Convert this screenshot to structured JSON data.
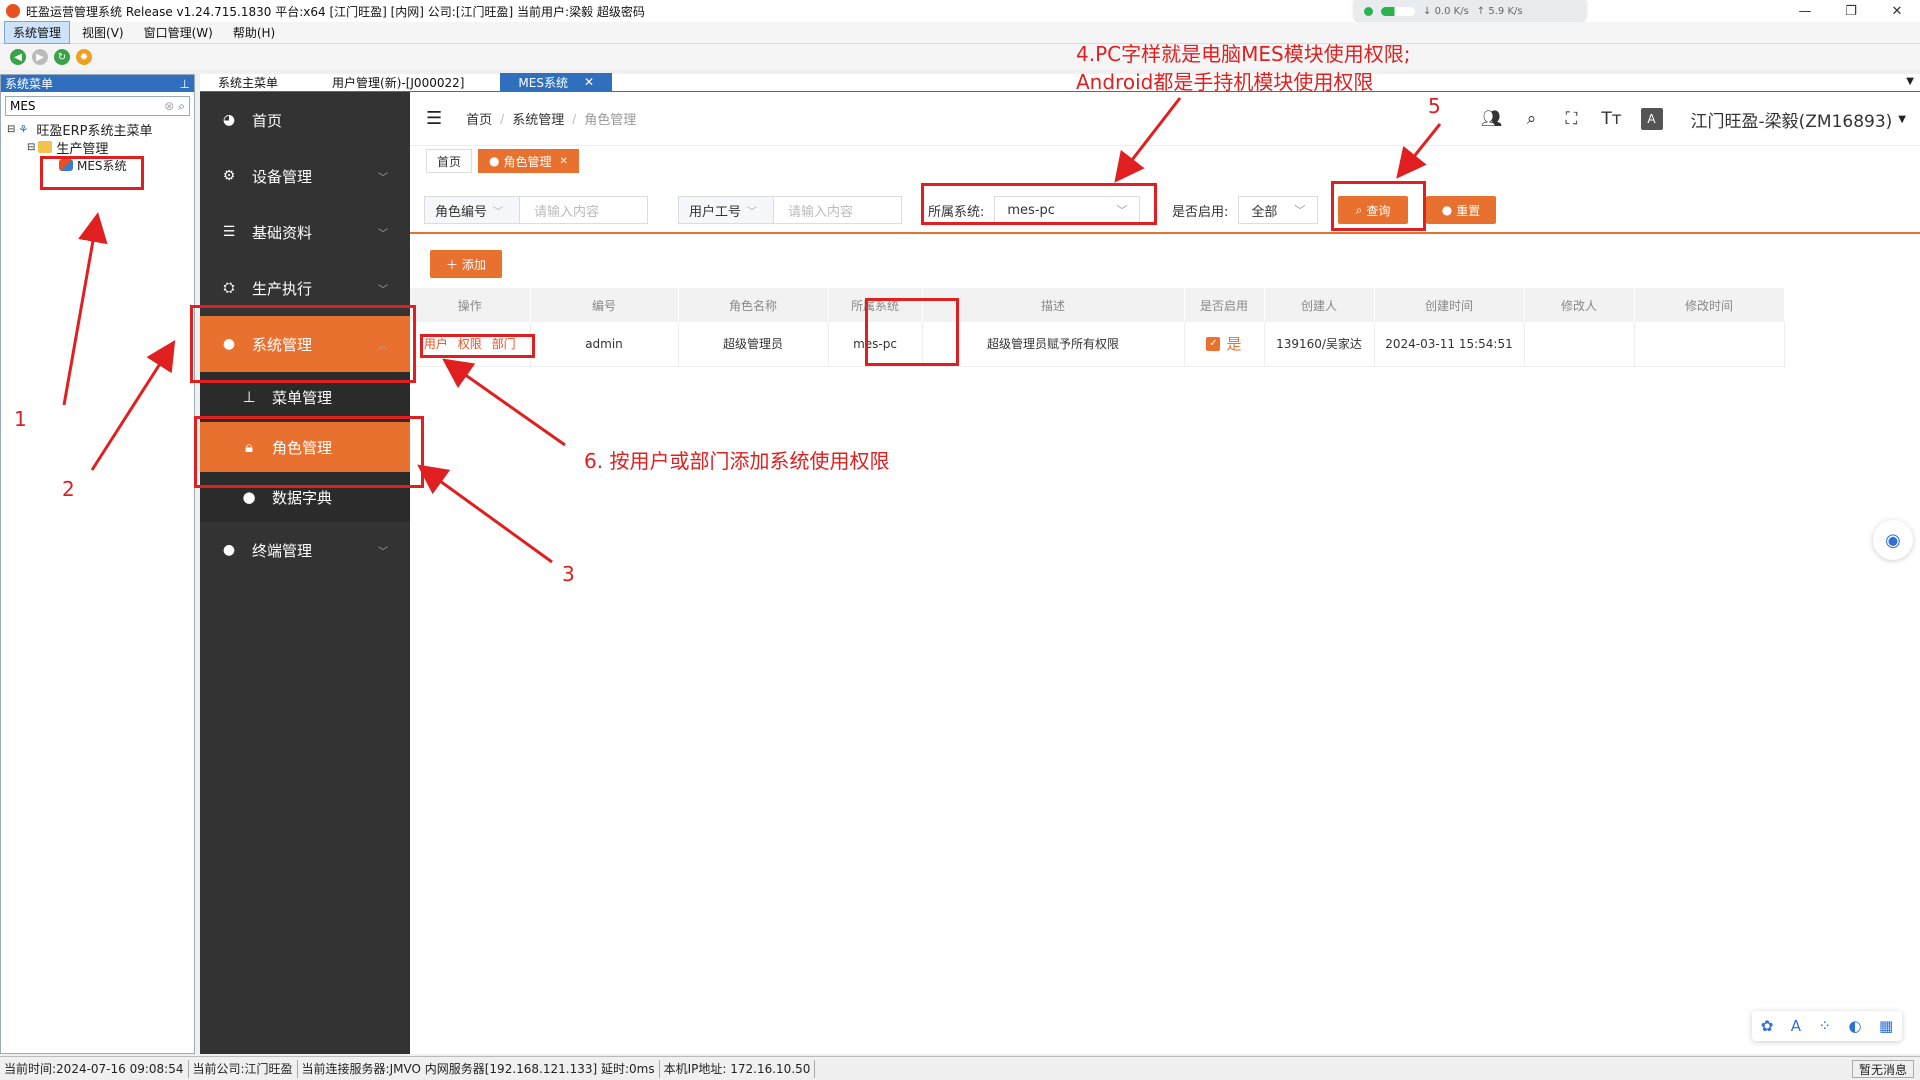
{
  "window": {
    "title": "旺盈运营管理系统 Release v1.24.715.1830 平台:x64 [江门旺盈] [内网] 公司:[江门旺盈] 当前用户:梁毅 超级密码",
    "netmon": {
      "down": "0.0",
      "up": "5.9",
      "unit": "K/s"
    }
  },
  "menubar": [
    "系统管理",
    "视图(V)",
    "窗口管理(W)",
    "帮助(H)"
  ],
  "left_panel": {
    "title": "系统菜单",
    "search_value": "MES",
    "tree": [
      {
        "label": "旺盈ERP系统主菜单",
        "level": 0
      },
      {
        "label": "生产管理",
        "level": 1
      },
      {
        "label": "MES系统",
        "level": 2
      }
    ]
  },
  "doc_tabs": [
    "系统主菜单",
    "用户管理(新)-[J000022]",
    "MES系统"
  ],
  "sidebar": {
    "items": [
      {
        "label": "首页",
        "icon": "dashboard-icon",
        "chev": false
      },
      {
        "label": "设备管理",
        "icon": "gears-icon",
        "chev": true
      },
      {
        "label": "基础资料",
        "icon": "list-icon",
        "chev": true
      },
      {
        "label": "生产执行",
        "icon": "factory-icon",
        "chev": true
      },
      {
        "label": "系统管理",
        "icon": "user-icon",
        "chev": true,
        "active": true
      }
    ],
    "sub_items": [
      {
        "label": "菜单管理",
        "icon": "sitemap-icon"
      },
      {
        "label": "角色管理",
        "icon": "lock-icon",
        "active": true
      },
      {
        "label": "数据字典",
        "icon": "user-icon"
      }
    ],
    "last_item": {
      "label": "终端管理",
      "icon": "user-icon"
    }
  },
  "breadcrumb": [
    "首页",
    "系统管理",
    "角色管理"
  ],
  "user_display": "江门旺盈-梁毅(ZM16893)",
  "view_tags": {
    "home": "首页",
    "current": "角色管理"
  },
  "filters": {
    "role_code_label": "角色编号",
    "role_code_placeholder": "请输入内容",
    "user_code_label": "用户工号",
    "user_code_placeholder": "请输入内容",
    "system_label": "所属系统:",
    "system_value": "mes-pc",
    "enabled_label": "是否启用:",
    "enabled_value": "全部",
    "query_button": "查询",
    "reset_button": "重置"
  },
  "add_button": "添加",
  "table": {
    "columns": [
      "操作",
      "编号",
      "角色名称",
      "所属系统",
      "描述",
      "是否启用",
      "创建人",
      "创建时间",
      "修改人",
      "修改时间"
    ],
    "rows": [
      {
        "ops": [
          "用户",
          "权限",
          "部门"
        ],
        "code": "admin",
        "name": "超级管理员",
        "system": "mes-pc",
        "desc": "超级管理员赋予所有权限",
        "enabled": "是",
        "creator": "139160/吴家达",
        "created": "2024-03-11 15:54:51",
        "modifier": "",
        "modified": ""
      }
    ]
  },
  "annotations": {
    "n1": "1",
    "n2": "2",
    "n3": "3",
    "n4_line1": "4.PC字样就是电脑MES模块使用权限;",
    "n4_line2": "Android都是手持机模块使用权限",
    "n5": "5",
    "n6": "6. 按用户或部门添加系统使用权限"
  },
  "statusbar": {
    "time": "当前时间:2024-07-16 09:08:54",
    "company": "当前公司:江门旺盈",
    "server": "当前连接服务器:JMVO 内网服务器[192.168.121.133] 延时:0ms",
    "ip": "本机IP地址: 172.16.10.50",
    "message": "暂无消息"
  },
  "colors": {
    "accent": "#e8712f",
    "annotation": "#e02020",
    "sidebar": "#333333",
    "header_blue": "#2f6fbd"
  }
}
